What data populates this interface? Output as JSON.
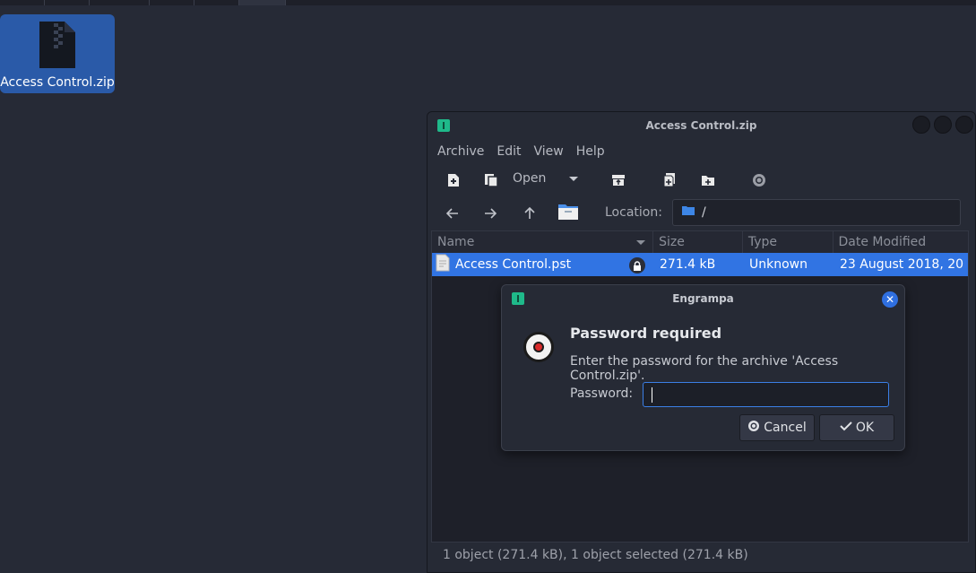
{
  "desktop": {
    "icon_label": "Access Control.zip"
  },
  "window": {
    "title": "Access Control.zip",
    "menu": [
      "Archive",
      "Edit",
      "View",
      "Help"
    ],
    "toolbar": {
      "open_label": "Open"
    },
    "location": {
      "label": "Location:",
      "path": "/"
    },
    "columns": [
      "Name",
      "Size",
      "Type",
      "Date Modified"
    ],
    "files": [
      {
        "name": "Access Control.pst",
        "size": "271.4 kB",
        "type": "Unknown",
        "modified": "23 August 2018, 20…",
        "locked": true
      }
    ],
    "status": "1 object (271.4 kB), 1 object selected (271.4 kB)"
  },
  "dialog": {
    "title": "Engrampa",
    "heading": "Password required",
    "message": "Enter the password for the archive 'Access Control.zip'.",
    "password_label": "Password:",
    "password_value": "",
    "cancel_label": "Cancel",
    "ok_label": "OK"
  },
  "colors": {
    "selection": "#3174e3",
    "accent": "#2f6fe0",
    "app_icon": "#1fb98a",
    "background": "#262a36"
  },
  "icons": [
    "zip-file-icon",
    "engrampa-app-icon",
    "new-archive-icon",
    "copy-archive-icon",
    "extract-icon",
    "add-files-icon",
    "add-folder-icon",
    "stop-icon",
    "back-arrow-icon",
    "forward-arrow-icon",
    "up-arrow-icon",
    "home-folder-icon",
    "folder-icon",
    "file-icon",
    "lock-icon",
    "close-icon",
    "password-icon",
    "cancel-icon",
    "check-icon"
  ]
}
